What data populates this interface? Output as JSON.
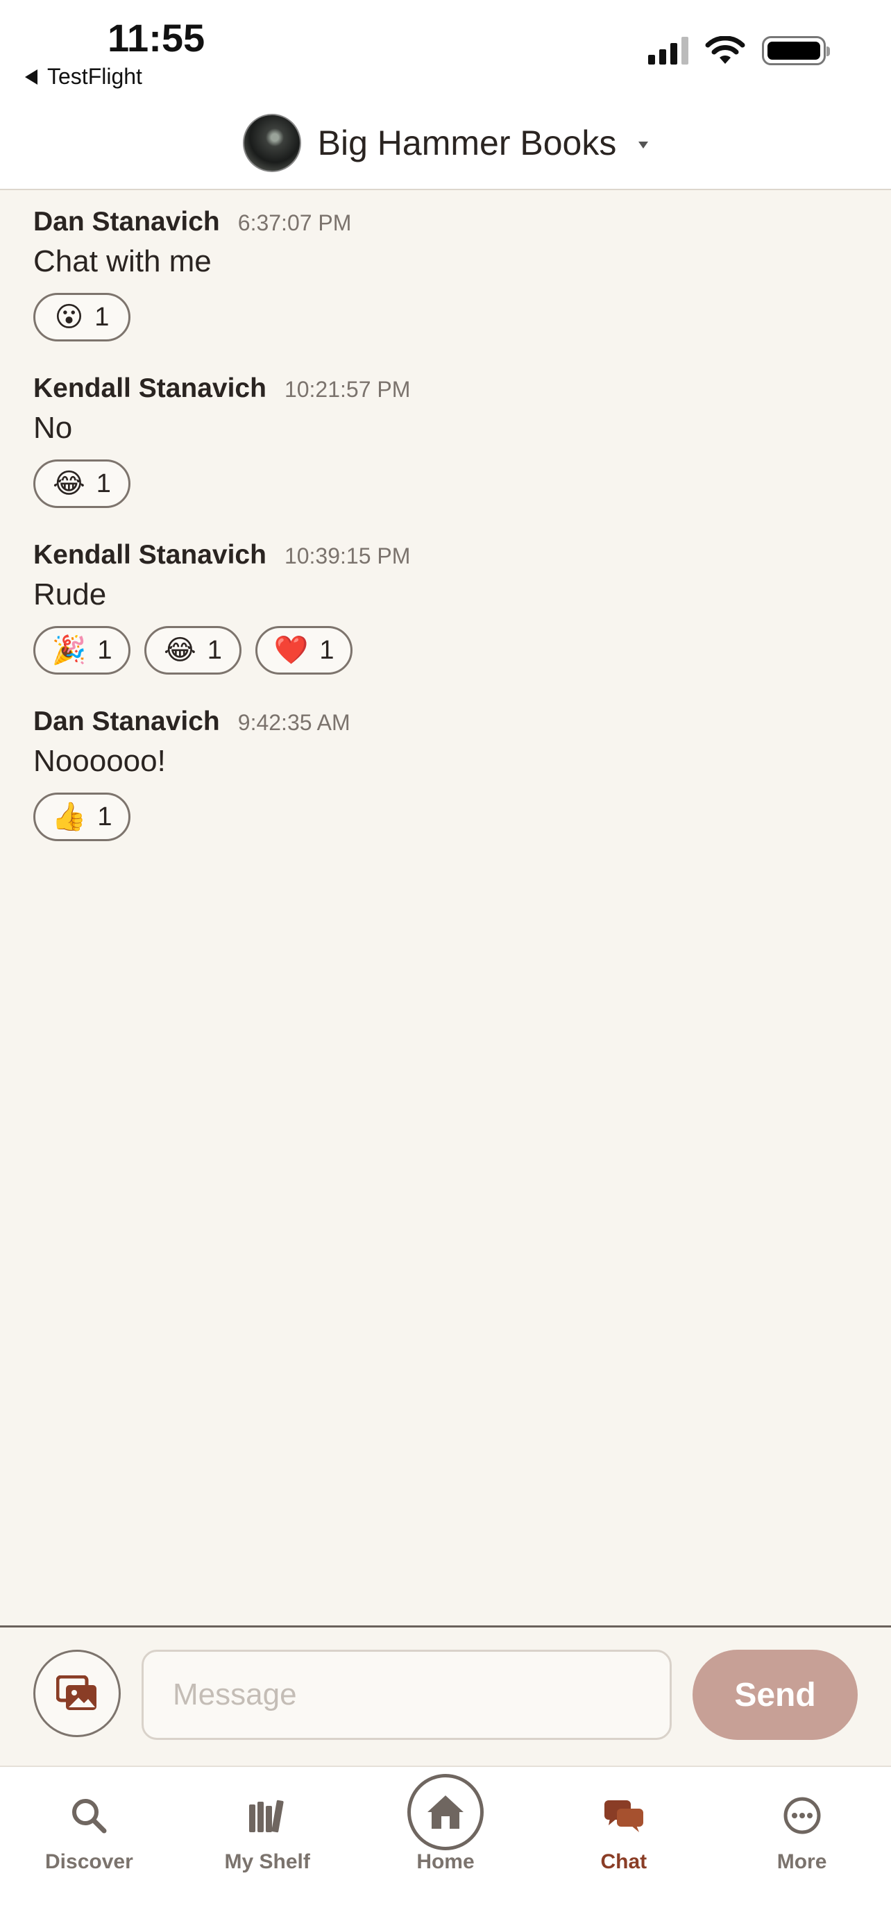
{
  "status_bar": {
    "time": "11:55",
    "back_app": "TestFlight",
    "icons": [
      "signal-icon",
      "wifi-icon",
      "battery-icon"
    ]
  },
  "header": {
    "group_name": "Big Hammer Books"
  },
  "messages": [
    {
      "author": "Dan Stanavich",
      "time": "6:37:07 PM",
      "text": "Chat with me",
      "reactions": [
        {
          "emoji": "😮",
          "count": "1"
        }
      ]
    },
    {
      "author": "Kendall Stanavich",
      "time": "10:21:57 PM",
      "text": "No",
      "reactions": [
        {
          "emoji": "😂",
          "count": "1"
        }
      ]
    },
    {
      "author": "Kendall Stanavich",
      "time": "10:39:15 PM",
      "text": "Rude",
      "reactions": [
        {
          "emoji": "🎉",
          "count": "1"
        },
        {
          "emoji": "😂",
          "count": "1"
        },
        {
          "emoji": "❤️",
          "count": "1"
        }
      ]
    },
    {
      "author": "Dan Stanavich",
      "time": "9:42:35 AM",
      "text": "Noooooo!",
      "reactions": [
        {
          "emoji": "👍",
          "count": "1"
        }
      ]
    }
  ],
  "composer": {
    "placeholder": "Message",
    "send_label": "Send"
  },
  "tabs": [
    {
      "label": "Discover",
      "icon": "search-icon",
      "active": false
    },
    {
      "label": "My Shelf",
      "icon": "bookshelf-icon",
      "active": false
    },
    {
      "label": "Home",
      "icon": "home-icon",
      "active": false
    },
    {
      "label": "Chat",
      "icon": "chat-bubbles-icon",
      "active": true
    },
    {
      "label": "More",
      "icon": "more-icon",
      "active": false
    }
  ],
  "colors": {
    "background": "#f8f5ef",
    "accent": "#8a3d26",
    "send_button": "#c7a096",
    "muted_text": "#7b736d"
  }
}
